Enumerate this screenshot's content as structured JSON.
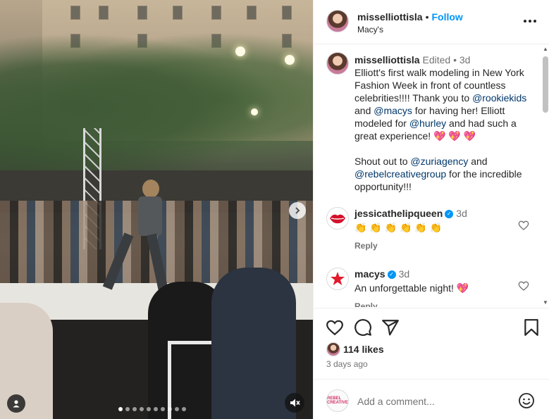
{
  "post": {
    "username": "misselliottisla",
    "separator": "•",
    "follow_label": "Follow",
    "location": "Macy's",
    "more_icon": "more-horizontal-icon"
  },
  "caption": {
    "username": "misselliottisla",
    "edited": "Edited",
    "dot": "•",
    "age": "3d",
    "segments": {
      "t1": "Elliott's first walk modeling in New York Fashion Week in front of countless celebrities!!!! Thank you to ",
      "m1": "@rookiekids",
      "t2": " and ",
      "m2": "@macys",
      "t3": " for having her!  Elliott modeled for ",
      "m3": "@hurley",
      "t4": " and had such a great experience! ",
      "hearts": "💖 💖 💖",
      "t5": "Shout out to ",
      "m4": "@zuriagency",
      "t6": " and ",
      "m5": "@rebelcreativegroup",
      "t7": " for the incredible opportunity!!!"
    }
  },
  "comments": [
    {
      "username": "jessicathelipqueen",
      "age": "3d",
      "text": "👏 👏 👏 👏 👏 👏",
      "reply_label": "Reply",
      "verified": true
    },
    {
      "username": "macys",
      "age": "3d",
      "text": "An unforgettable night! 💖",
      "reply_label": "Reply",
      "verified": true
    }
  ],
  "actions": {
    "likes": "114 likes",
    "time": "3 days ago"
  },
  "add_comment": {
    "placeholder": "Add a comment...",
    "avatar_text": "REBEL CREATIVE"
  },
  "colors": {
    "link": "#00376b",
    "follow": "#0095f6",
    "muted": "#737373",
    "heart": "#e0245e"
  },
  "carousel": {
    "slides": 10,
    "active_index": 0
  }
}
